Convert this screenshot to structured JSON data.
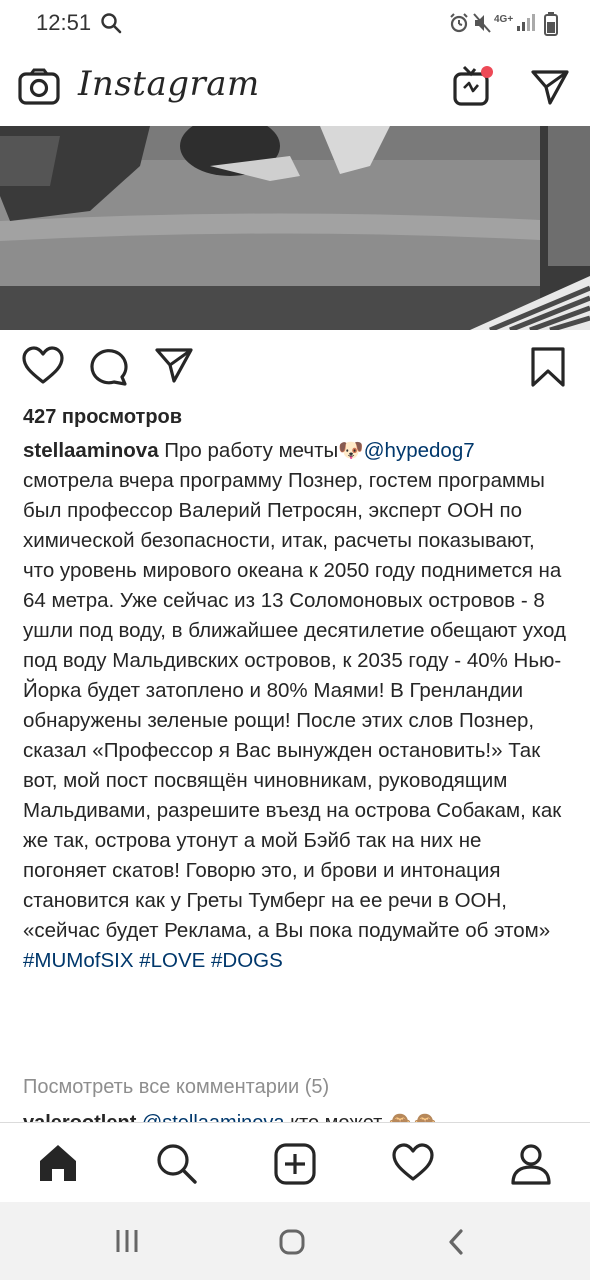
{
  "status_bar": {
    "time": "12:51",
    "network": "4G+",
    "icons": [
      "search-icon",
      "alarm-icon",
      "mute-icon",
      "signal-icon",
      "battery-icon"
    ]
  },
  "header": {
    "logo_text": "Instagram",
    "icons": [
      "camera-icon",
      "igtv-icon",
      "direct-message-icon"
    ]
  },
  "post": {
    "views": "427 просмотров",
    "caption": {
      "username": "stellaaminova",
      "text_before_mention": "Про работу мечты",
      "emoji": "🐶",
      "mention": "@hypedog7",
      "body": "смотрела вчера программу Познер, гостем программы был профессор Валерий Петросян, эксперт ООН по химической безопасности, итак, расчеты показывают, что уровень мирового океана к 2050 году поднимется на 64 метра. Уже сейчас из 13 Соломоновых островов - 8 ушли под воду, в ближайшее десятилетие обещают уход под воду Мальдивских островов, к 2035 году - 40% Нью-Йорка будет затоплено и 80% Маями! В Гренландии обнаружены зеленые рощи! После этих слов Познер, сказал «Профессор я Вас вынужден остановить!» Так вот, мой пост посвящён чиновникам, руководящим Мальдивами, разрешите въезд на острова Собакам, как же так, острова утонут а мой Бэйб так на них не погоняет скатов! Говорю это, и брови и интонация становится как у Греты Тумберг на ее речи в ООН, «сейчас будет Реклама, а Вы пока подумайте об этом»",
      "hashtags": [
        "#MUMofSIX",
        "#LOVE",
        "#DOGS"
      ]
    },
    "view_all_comments": "Посмотреть все комментарии (5)",
    "first_comment": {
      "username": "valerootlent",
      "mention": "@stellaaminova",
      "text": "кто может",
      "emoji": "🙈🙈"
    }
  },
  "bottom_nav": [
    "home-icon",
    "search-icon",
    "new-post-icon",
    "activity-icon",
    "profile-icon"
  ],
  "system_nav": [
    "recents-button",
    "home-button",
    "back-button"
  ],
  "colors": {
    "link": "#00376b",
    "notification_dot": "#ed4956",
    "muted_text": "#8e8e8e"
  }
}
